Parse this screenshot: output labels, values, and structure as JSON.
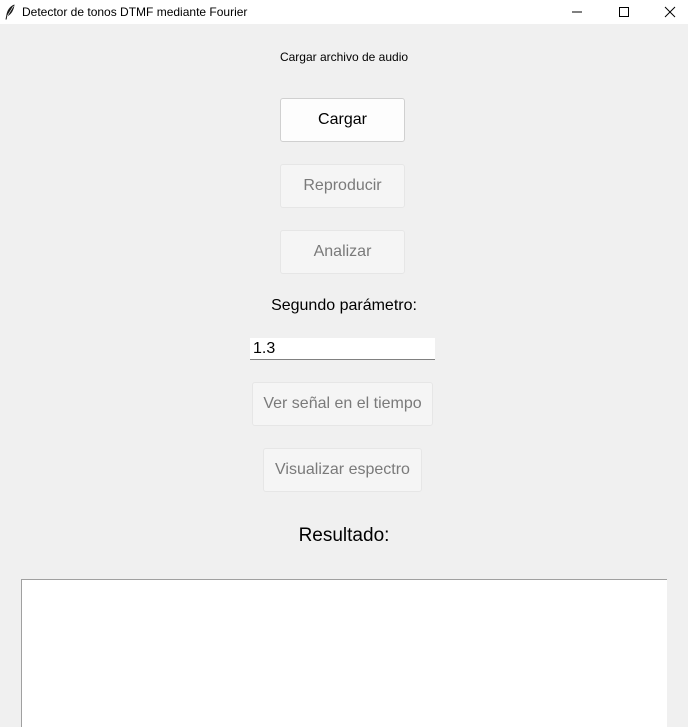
{
  "window": {
    "title": "Detector de tonos DTMF mediante Fourier"
  },
  "header": {
    "instruction": "Cargar archivo de audio"
  },
  "buttons": {
    "load": "Cargar",
    "play": "Reproducir",
    "analyze": "Analizar",
    "time_signal": "Ver señal en el tiempo",
    "spectrum": "Visualizar espectro"
  },
  "param": {
    "label": "Segundo parámetro:",
    "value": "1.3"
  },
  "result": {
    "label": "Resultado:",
    "text": ""
  },
  "icons": {
    "app": "feather-icon",
    "minimize": "minimize-icon",
    "maximize": "maximize-icon",
    "close": "close-icon"
  }
}
